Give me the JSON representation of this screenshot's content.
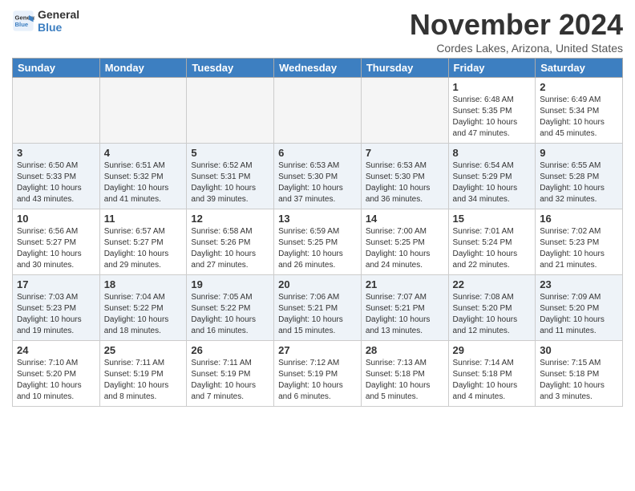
{
  "header": {
    "logo_line1": "General",
    "logo_line2": "Blue",
    "month_year": "November 2024",
    "location": "Cordes Lakes, Arizona, United States"
  },
  "days_of_week": [
    "Sunday",
    "Monday",
    "Tuesday",
    "Wednesday",
    "Thursday",
    "Friday",
    "Saturday"
  ],
  "weeks": [
    [
      {
        "day": "",
        "info": ""
      },
      {
        "day": "",
        "info": ""
      },
      {
        "day": "",
        "info": ""
      },
      {
        "day": "",
        "info": ""
      },
      {
        "day": "",
        "info": ""
      },
      {
        "day": "1",
        "info": "Sunrise: 6:48 AM\nSunset: 5:35 PM\nDaylight: 10 hours\nand 47 minutes."
      },
      {
        "day": "2",
        "info": "Sunrise: 6:49 AM\nSunset: 5:34 PM\nDaylight: 10 hours\nand 45 minutes."
      }
    ],
    [
      {
        "day": "3",
        "info": "Sunrise: 6:50 AM\nSunset: 5:33 PM\nDaylight: 10 hours\nand 43 minutes."
      },
      {
        "day": "4",
        "info": "Sunrise: 6:51 AM\nSunset: 5:32 PM\nDaylight: 10 hours\nand 41 minutes."
      },
      {
        "day": "5",
        "info": "Sunrise: 6:52 AM\nSunset: 5:31 PM\nDaylight: 10 hours\nand 39 minutes."
      },
      {
        "day": "6",
        "info": "Sunrise: 6:53 AM\nSunset: 5:30 PM\nDaylight: 10 hours\nand 37 minutes."
      },
      {
        "day": "7",
        "info": "Sunrise: 6:53 AM\nSunset: 5:30 PM\nDaylight: 10 hours\nand 36 minutes."
      },
      {
        "day": "8",
        "info": "Sunrise: 6:54 AM\nSunset: 5:29 PM\nDaylight: 10 hours\nand 34 minutes."
      },
      {
        "day": "9",
        "info": "Sunrise: 6:55 AM\nSunset: 5:28 PM\nDaylight: 10 hours\nand 32 minutes."
      }
    ],
    [
      {
        "day": "10",
        "info": "Sunrise: 6:56 AM\nSunset: 5:27 PM\nDaylight: 10 hours\nand 30 minutes."
      },
      {
        "day": "11",
        "info": "Sunrise: 6:57 AM\nSunset: 5:27 PM\nDaylight: 10 hours\nand 29 minutes."
      },
      {
        "day": "12",
        "info": "Sunrise: 6:58 AM\nSunset: 5:26 PM\nDaylight: 10 hours\nand 27 minutes."
      },
      {
        "day": "13",
        "info": "Sunrise: 6:59 AM\nSunset: 5:25 PM\nDaylight: 10 hours\nand 26 minutes."
      },
      {
        "day": "14",
        "info": "Sunrise: 7:00 AM\nSunset: 5:25 PM\nDaylight: 10 hours\nand 24 minutes."
      },
      {
        "day": "15",
        "info": "Sunrise: 7:01 AM\nSunset: 5:24 PM\nDaylight: 10 hours\nand 22 minutes."
      },
      {
        "day": "16",
        "info": "Sunrise: 7:02 AM\nSunset: 5:23 PM\nDaylight: 10 hours\nand 21 minutes."
      }
    ],
    [
      {
        "day": "17",
        "info": "Sunrise: 7:03 AM\nSunset: 5:23 PM\nDaylight: 10 hours\nand 19 minutes."
      },
      {
        "day": "18",
        "info": "Sunrise: 7:04 AM\nSunset: 5:22 PM\nDaylight: 10 hours\nand 18 minutes."
      },
      {
        "day": "19",
        "info": "Sunrise: 7:05 AM\nSunset: 5:22 PM\nDaylight: 10 hours\nand 16 minutes."
      },
      {
        "day": "20",
        "info": "Sunrise: 7:06 AM\nSunset: 5:21 PM\nDaylight: 10 hours\nand 15 minutes."
      },
      {
        "day": "21",
        "info": "Sunrise: 7:07 AM\nSunset: 5:21 PM\nDaylight: 10 hours\nand 13 minutes."
      },
      {
        "day": "22",
        "info": "Sunrise: 7:08 AM\nSunset: 5:20 PM\nDaylight: 10 hours\nand 12 minutes."
      },
      {
        "day": "23",
        "info": "Sunrise: 7:09 AM\nSunset: 5:20 PM\nDaylight: 10 hours\nand 11 minutes."
      }
    ],
    [
      {
        "day": "24",
        "info": "Sunrise: 7:10 AM\nSunset: 5:20 PM\nDaylight: 10 hours\nand 10 minutes."
      },
      {
        "day": "25",
        "info": "Sunrise: 7:11 AM\nSunset: 5:19 PM\nDaylight: 10 hours\nand 8 minutes."
      },
      {
        "day": "26",
        "info": "Sunrise: 7:11 AM\nSunset: 5:19 PM\nDaylight: 10 hours\nand 7 minutes."
      },
      {
        "day": "27",
        "info": "Sunrise: 7:12 AM\nSunset: 5:19 PM\nDaylight: 10 hours\nand 6 minutes."
      },
      {
        "day": "28",
        "info": "Sunrise: 7:13 AM\nSunset: 5:18 PM\nDaylight: 10 hours\nand 5 minutes."
      },
      {
        "day": "29",
        "info": "Sunrise: 7:14 AM\nSunset: 5:18 PM\nDaylight: 10 hours\nand 4 minutes."
      },
      {
        "day": "30",
        "info": "Sunrise: 7:15 AM\nSunset: 5:18 PM\nDaylight: 10 hours\nand 3 minutes."
      }
    ]
  ]
}
